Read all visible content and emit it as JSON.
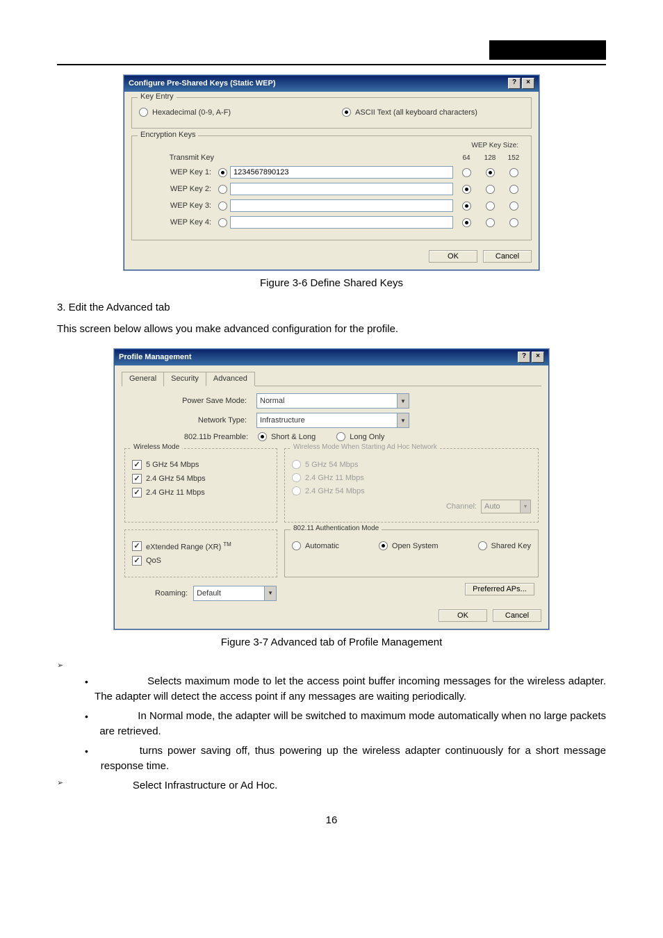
{
  "dialog1": {
    "title": "Configure Pre-Shared Keys (Static WEP)",
    "help_btn": "?",
    "close_btn": "×",
    "group_key_entry": "Key Entry",
    "hex_label": "Hexadecimal (0-9, A-F)",
    "ascii_label": "ASCII Text (all keyboard characters)",
    "group_encryption": "Encryption Keys",
    "wep_key_size": "WEP Key Size:",
    "size_64": "64",
    "size_128": "128",
    "size_152": "152",
    "transmit_key": "Transmit Key",
    "rows": [
      {
        "label": "WEP Key 1:",
        "value": "1234567890123",
        "transmit_checked": true,
        "size_selected": 1
      },
      {
        "label": "WEP Key 2:",
        "value": "",
        "transmit_checked": false,
        "size_selected": 0
      },
      {
        "label": "WEP Key 3:",
        "value": "",
        "transmit_checked": false,
        "size_selected": 0
      },
      {
        "label": "WEP Key 4:",
        "value": "",
        "transmit_checked": false,
        "size_selected": 0
      }
    ],
    "ok": "OK",
    "cancel": "Cancel"
  },
  "caption1": "Figure 3-6 Define Shared Keys",
  "step3": "3.    Edit the Advanced tab",
  "body1": "This screen below allows you make advanced configuration for the profile.",
  "dialog2": {
    "title": "Profile Management",
    "help_btn": "?",
    "close_btn": "×",
    "tabs": [
      "General",
      "Security",
      "Advanced"
    ],
    "power_save_label": "Power Save Mode:",
    "power_save_value": "Normal",
    "network_type_label": "Network Type:",
    "network_type_value": "Infrastructure",
    "preamble_label": "802.11b Preamble:",
    "preamble_short": "Short & Long",
    "preamble_long": "Long Only",
    "wireless_mode_title": "Wireless Mode",
    "adhoc_title": "Wireless Mode When Starting Ad Hoc Network",
    "mode_5_54": "5 GHz 54 Mbps",
    "mode_24_54": "2.4 GHz 54 Mbps",
    "mode_24_11": "2.4 GHz 11 Mbps",
    "adhoc_5_54": "5 GHz 54 Mbps",
    "adhoc_24_11": "2.4 GHz 11 Mbps",
    "adhoc_24_54": "2.4 GHz 54 Mbps",
    "channel_label": "Channel:",
    "channel_value": "Auto",
    "xr_label": "eXtended Range (XR)",
    "xr_tm": "TM",
    "qos_label": "QoS",
    "auth_title": "802.11 Authentication Mode",
    "auth_auto": "Automatic",
    "auth_open": "Open System",
    "auth_shared": "Shared Key",
    "roaming_label": "Roaming:",
    "roaming_value": "Default",
    "preferred_aps": "Preferred APs...",
    "ok": "OK",
    "cancel": "Cancel"
  },
  "caption2": "Figure 3-7 Advanced tab of Profile Management",
  "bullets": {
    "b1": "Selects maximum mode to let the access point buffer incoming messages for the wireless adapter.   The adapter will detect the access point if any messages are waiting periodically.",
    "b2": "In Normal mode, the adapter will be switched to maximum mode automatically when no large packets are retrieved.",
    "b3": "turns power saving off, thus powering up the wireless adapter continuously for a short message response time.",
    "b4": "Select Infrastructure or Ad Hoc."
  },
  "page_number": "16"
}
